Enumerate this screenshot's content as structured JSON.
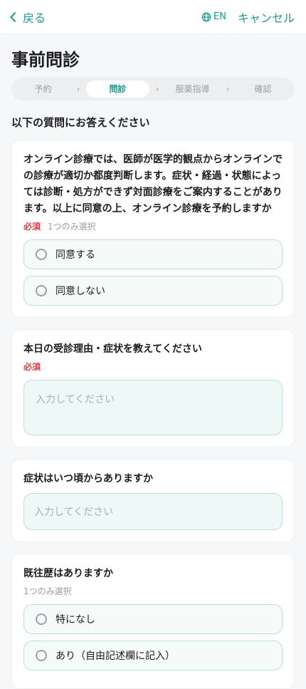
{
  "header": {
    "back_label": "戻る",
    "lang_label": "EN",
    "cancel_label": "キャンセル"
  },
  "page_title": "事前問診",
  "steps": [
    {
      "label": "予約",
      "active": false
    },
    {
      "label": "問診",
      "active": true
    },
    {
      "label": "服薬指導",
      "active": false
    },
    {
      "label": "確認",
      "active": false
    }
  ],
  "section_heading": "以下の質問にお答えください",
  "questions": [
    {
      "text": "オンライン診療では、医師が医学的観点からオンラインでの診療が適切か都度判断します。症状・経過・状態によっては診断・処方ができず対面診療をご案内することがあります。以上に同意の上、オンライン診療を予約しますか",
      "required": "必須",
      "hint": "1つのみ選択",
      "options": [
        "同意する",
        "同意しない"
      ]
    },
    {
      "text": "本日の受診理由・症状を教えてください",
      "required": "必須",
      "placeholder": "入力してください"
    },
    {
      "text": "症状はいつ頃からありますか",
      "placeholder": "入力してください"
    },
    {
      "text": "既往歴はありますか",
      "hint": "1つのみ選択",
      "options": [
        "特になし",
        "あり（自由記述欄に記入）"
      ]
    }
  ],
  "colors": {
    "accent": "#1a9a8f",
    "required": "#e5393e"
  }
}
